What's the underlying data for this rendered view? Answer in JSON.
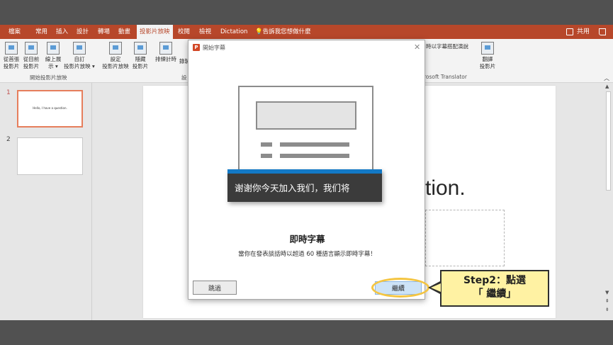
{
  "ribbon_tabs": [
    "檔案",
    "常用",
    "插入",
    "設計",
    "轉場",
    "動畫",
    "投影片放映",
    "校閱",
    "檢視",
    "Dictation"
  ],
  "ribbon_active_tab": "投影片放映",
  "tell_me": "告訴我您想做什麼",
  "share_label": "共用",
  "ribbon": {
    "btn_from_beginning": "從首張\n投影片",
    "btn_from_current": "從目前\n投影片",
    "btn_online": "線上展\n示 ▾",
    "btn_custom": "自訂\n投影片放映 ▾",
    "btn_setup": "設定\n投影片放映",
    "btn_hide": "隱藏\n投影片",
    "btn_rehearse": "排練計時",
    "btn_record_partial": "錄製",
    "group_start": "開始投影片放映",
    "group_setup_partial": "設",
    "subtitle_partial": "時以字幕搭配演說",
    "translator_partial": "rosoft Translator",
    "btn_translate": "翻譯\n投影片"
  },
  "thumbnails": [
    {
      "num": "1",
      "text": "Hello, I have a question."
    },
    {
      "num": "2",
      "text": ""
    }
  ],
  "slide": {
    "title_visible": "tion."
  },
  "dialog": {
    "title": "開始字幕",
    "logo": "P",
    "caption_sample": "谢谢你今天加入我们，我们将",
    "heading": "即時字幕",
    "description": "當你在發表談話時以超過 60 種語言顯示即時字幕！",
    "skip_label": "跳過",
    "continue_label": "繼續"
  },
  "callout": {
    "line1": "Step2：點選",
    "line2": "「 繼續」",
    "fill_color": "#fff2a3",
    "highlight_color": "#f4c542"
  },
  "colors": {
    "ribbon_accent": "#b7472a",
    "caption_bar": "#1379c6"
  }
}
